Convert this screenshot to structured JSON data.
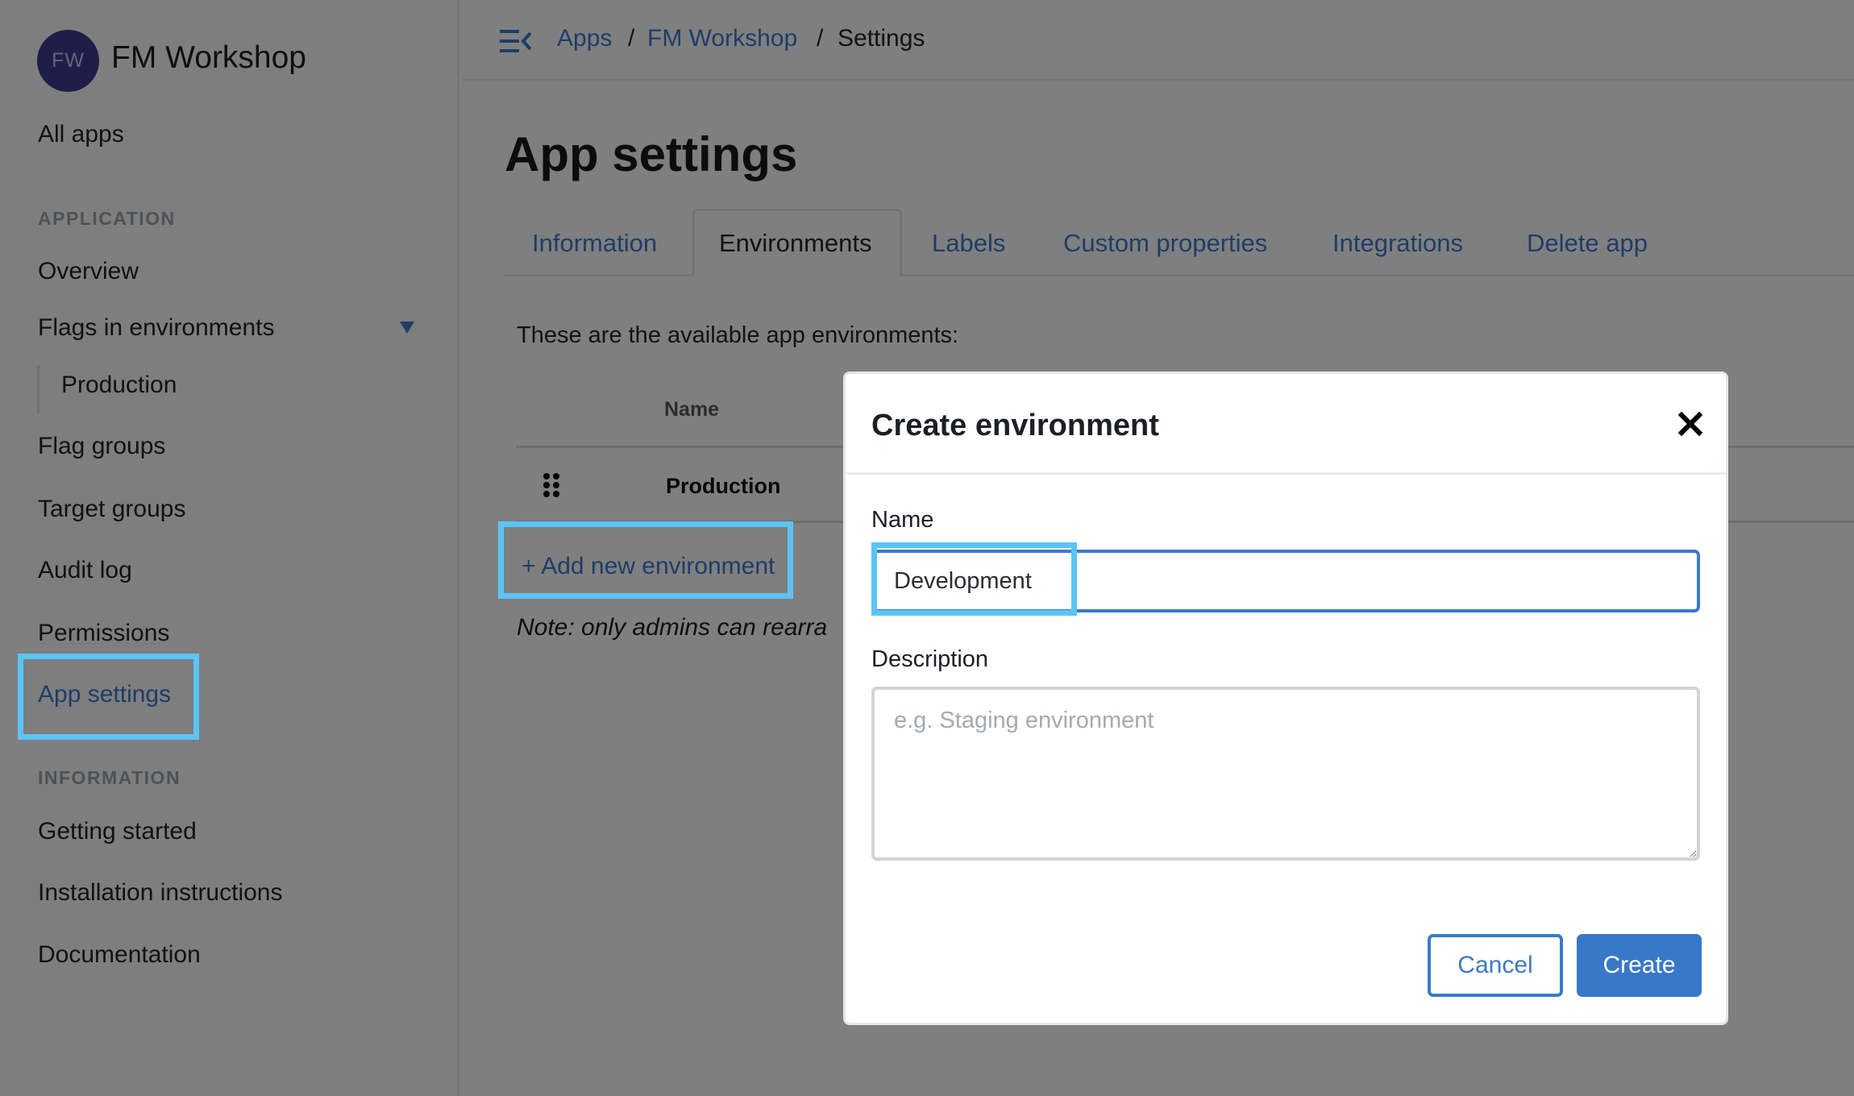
{
  "sidebar": {
    "avatar_initials": "FW",
    "org_name": "FM Workshop",
    "all_apps": "All apps",
    "sections": {
      "application": "APPLICATION",
      "information": "INFORMATION"
    },
    "items": {
      "overview": "Overview",
      "flags_in_environments": "Flags in environments",
      "production": "Production",
      "flag_groups": "Flag groups",
      "target_groups": "Target groups",
      "audit_log": "Audit log",
      "permissions": "Permissions",
      "app_settings": "App settings",
      "getting_started": "Getting started",
      "installation_instructions": "Installation instructions",
      "documentation": "Documentation"
    },
    "active_item": "App settings"
  },
  "header": {
    "breadcrumb": [
      {
        "label": "Apps"
      },
      {
        "label": "FM Workshop"
      },
      {
        "label": "Settings"
      }
    ],
    "separator": "/"
  },
  "main": {
    "title": "App settings",
    "tabs": [
      {
        "label": "Information"
      },
      {
        "label": "Environments",
        "active": true
      },
      {
        "label": "Labels"
      },
      {
        "label": "Custom properties"
      },
      {
        "label": "Integrations"
      },
      {
        "label": "Delete app"
      }
    ],
    "intro_text": "These are the available app environments:",
    "table": {
      "columns": [
        "Name"
      ],
      "rows": [
        {
          "name": "Production"
        }
      ]
    },
    "add_environment_label": "+ Add new environment",
    "note": "Note: only admins can rearra"
  },
  "modal": {
    "title": "Create environment",
    "close_icon": "close-icon",
    "name_label": "Name",
    "name_value": "Development",
    "description_label": "Description",
    "description_placeholder": "e.g. Staging environment",
    "description_value": "",
    "cancel_label": "Cancel",
    "create_label": "Create"
  },
  "colors": {
    "accent": "#3878c8",
    "highlight": "#5bc4f7",
    "avatar": "#3f3c91"
  }
}
